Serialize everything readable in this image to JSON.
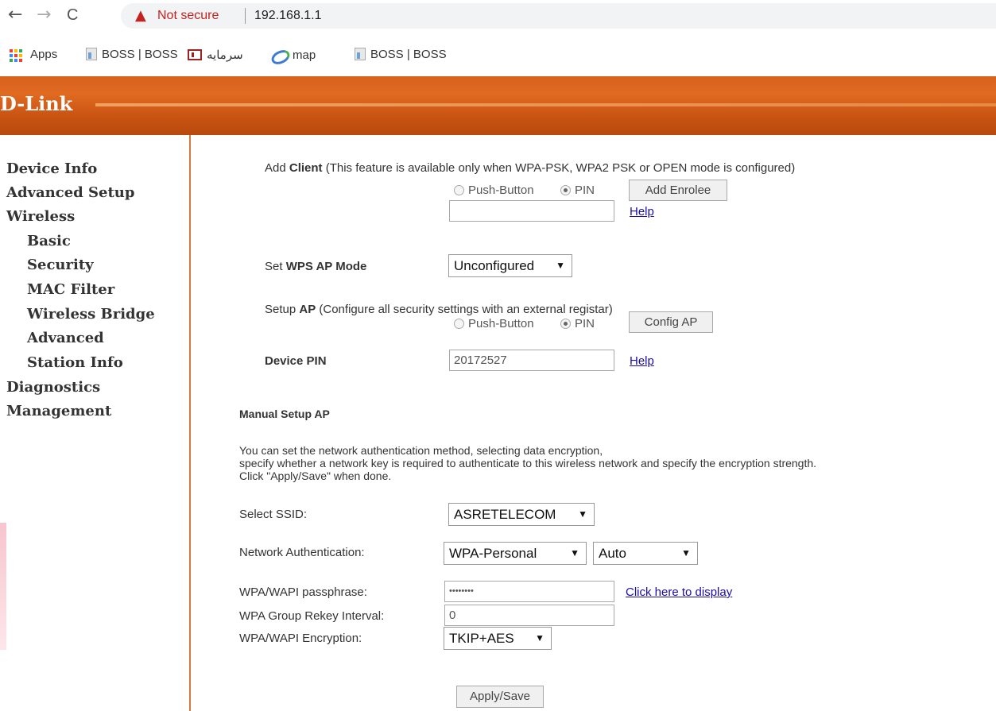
{
  "browser": {
    "back": "←",
    "forward": "→",
    "reload": "C",
    "security_warning": "Not secure",
    "url": "192.168.1.1",
    "bookmarks": [
      "Apps",
      "BOSS | BOSS",
      "سرمایه",
      "map",
      "BOSS | BOSS"
    ]
  },
  "brand": {
    "logo": "D-Link"
  },
  "sidebar": {
    "items": [
      {
        "label": "Device Info"
      },
      {
        "label": "Advanced Setup"
      },
      {
        "label": "Wireless"
      },
      {
        "label": "Basic"
      },
      {
        "label": "Security"
      },
      {
        "label": "MAC Filter"
      },
      {
        "label": "Wireless Bridge"
      },
      {
        "label": "Advanced"
      },
      {
        "label": "Station Info"
      },
      {
        "label": "Diagnostics"
      },
      {
        "label": "Management"
      }
    ]
  },
  "wps": {
    "add_client_prefix": "Add ",
    "add_client_bold": "Client",
    "add_client_note": " (This feature is available only when WPA-PSK, WPA2 PSK or OPEN mode is configured)",
    "push_button_label": "Push-Button",
    "pin_label": "PIN",
    "add_enrolee_button": "Add Enrolee",
    "client_pin_value": "",
    "help_link": "Help",
    "wps_mode_prefix": "Set ",
    "wps_mode_bold": "WPS AP Mode",
    "wps_mode_value": "Unconfigured",
    "setup_ap_prefix": "Setup ",
    "setup_ap_bold": "AP",
    "setup_ap_note": " (Configure all security settings with an external registar)",
    "config_ap_button": "Config AP",
    "device_pin_label": "Device PIN",
    "device_pin_value": "20172527"
  },
  "manual": {
    "heading": "Manual Setup AP",
    "desc_line1": "You can set the network authentication method, selecting data encryption,",
    "desc_line2": "specify whether a network key is required to authenticate to this wireless network and specify the encryption strength.",
    "desc_line3": "Click \"Apply/Save\" when done.",
    "ssid_label": "Select SSID:",
    "ssid_value": "ASRETELECOM",
    "auth_label": "Network Authentication:",
    "auth_value": "WPA-Personal",
    "auth_mode_value": "Auto",
    "passphrase_label": "WPA/WAPI passphrase:",
    "passphrase_value": "••••••••",
    "display_link": "Click here to display",
    "rekey_label": "WPA Group Rekey Interval:",
    "rekey_value": "0",
    "encryption_label": "WPA/WAPI Encryption:",
    "encryption_value": "TKIP+AES",
    "apply_button": "Apply/Save"
  },
  "colors": {
    "banner": "#d9621c",
    "sidebar_border": "#d57a3e",
    "link": "#1a0dab",
    "warning": "#c5221f"
  }
}
